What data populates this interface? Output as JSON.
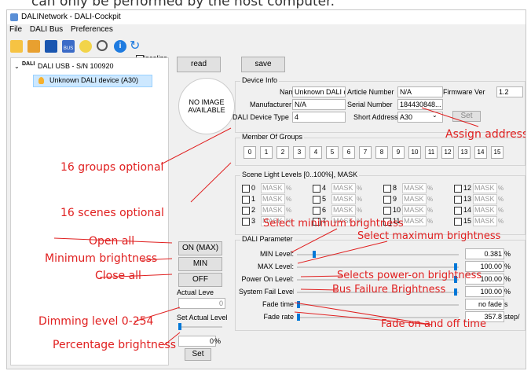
{
  "caption": "can only be performed by the host computer.",
  "window": {
    "title": "DALINetwork - DALI-Cockpit"
  },
  "menu": {
    "file": "File",
    "dalibus": "DALI Bus",
    "preferences": "Preferences"
  },
  "toolbar": {
    "localize": "localize",
    "read": "read",
    "save": "save"
  },
  "tree": {
    "root": "DALI USB - S/N 100920",
    "child": "Unknown DALI device (A30)"
  },
  "device_info": {
    "title": "Device Info",
    "noimage": "NO IMAGE AVAILABLE",
    "name_label": "Name",
    "name_value": "Unknown DALI d...",
    "article_label": "Article Number",
    "article_value": "N/A",
    "firmware_label": "Firmware Ver",
    "firmware_value": "1.2",
    "manufacturer_label": "Manufacturer",
    "manufacturer_value": "N/A",
    "serial_label": "Serial Number",
    "serial_value": "184430848...",
    "devtype_label": "DALI Device Type",
    "devtype_value": "4",
    "shortaddr_label": "Short Address",
    "shortaddr_value": "A30",
    "set_label": "Set"
  },
  "groups": {
    "title": "Member Of Groups",
    "items": [
      "0",
      "1",
      "2",
      "3",
      "4",
      "5",
      "6",
      "7",
      "8",
      "9",
      "10",
      "11",
      "12",
      "13",
      "14",
      "15"
    ]
  },
  "scenes": {
    "title": "Scene Light Levels [0..100%], MASK",
    "mask": "MASK",
    "pct": "%",
    "items": [
      "0",
      "1",
      "2",
      "3",
      "4",
      "5",
      "6",
      "7",
      "8",
      "9",
      "10",
      "11",
      "12",
      "13",
      "14",
      "15"
    ]
  },
  "left": {
    "on_label": "ON (MAX)",
    "min_label": "MIN",
    "off_label": "OFF",
    "actual_label": "Actual Leve",
    "actual_value": "0",
    "set_actual_label": "Set Actual Level",
    "pct_value": "0",
    "pct_unit": "%",
    "set_label": "Set"
  },
  "param": {
    "title": "DALI Parameter",
    "min_label": "MIN Level:",
    "min_value": "0.381",
    "min_unit": "%",
    "min_pos": 0.1,
    "max_label": "MAX Level:",
    "max_value": "100.00",
    "max_unit": "%",
    "max_pos": 0.99,
    "poweron_label": "Power On Level:",
    "poweron_value": "100.00",
    "poweron_unit": "%",
    "poweron_pos": 0.99,
    "sysfail_label": "System Fail Level:",
    "sysfail_value": "100.00",
    "sysfail_unit": "%",
    "sysfail_pos": 0.99,
    "fadetime_label": "Fade time",
    "fadetime_value": "no fade",
    "fadetime_unit": "s",
    "fadetime_pos": 0.0,
    "faderate_label": "Fade rate",
    "faderate_value": "357.8",
    "faderate_unit": "step/",
    "faderate_pos": 0.0
  },
  "annotations": {
    "assign": "Assign address",
    "groups16": "16 groups optional",
    "scenes16": "16 scenes optional",
    "selmin": "Select minimum brightness",
    "selmax": "Select maximum brightness",
    "openall": "Open all",
    "minbright": "Minimum brightness",
    "closeall": "Close all",
    "poweron": "Selects power-on brightness",
    "busfail": "Bus Failure Brightness",
    "dimming": "Dimming level 0-254",
    "fade": "Fade on and off time",
    "percentage": "Percentage brightness"
  },
  "colors": {
    "annotation": "#e02020",
    "accent": "#0078d7"
  }
}
